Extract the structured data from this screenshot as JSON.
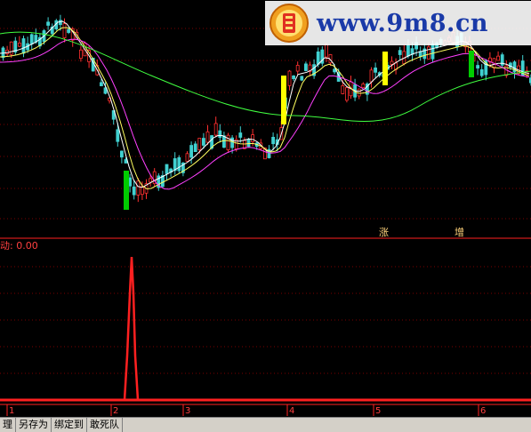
{
  "indicator": {
    "label": "动: 0.00"
  },
  "annotations": [
    "涨",
    "增"
  ],
  "axis": {
    "labels": [
      "1",
      "2",
      "3",
      "4",
      "5",
      "6"
    ]
  },
  "tabs": [
    "理",
    "另存为",
    "绑定到",
    "敢死队"
  ],
  "watermark": {
    "text": "www.9m8.cn"
  },
  "colors": {
    "up": "#ff3030",
    "down": "#40d0d0",
    "ma1": "#ffffff",
    "ma2": "#ffff60",
    "ma3": "#ff40ff",
    "ma4": "#40ff40",
    "signal_green": "#00cc00",
    "signal_yellow": "#ffff00",
    "osc": "#ff2020"
  }
}
